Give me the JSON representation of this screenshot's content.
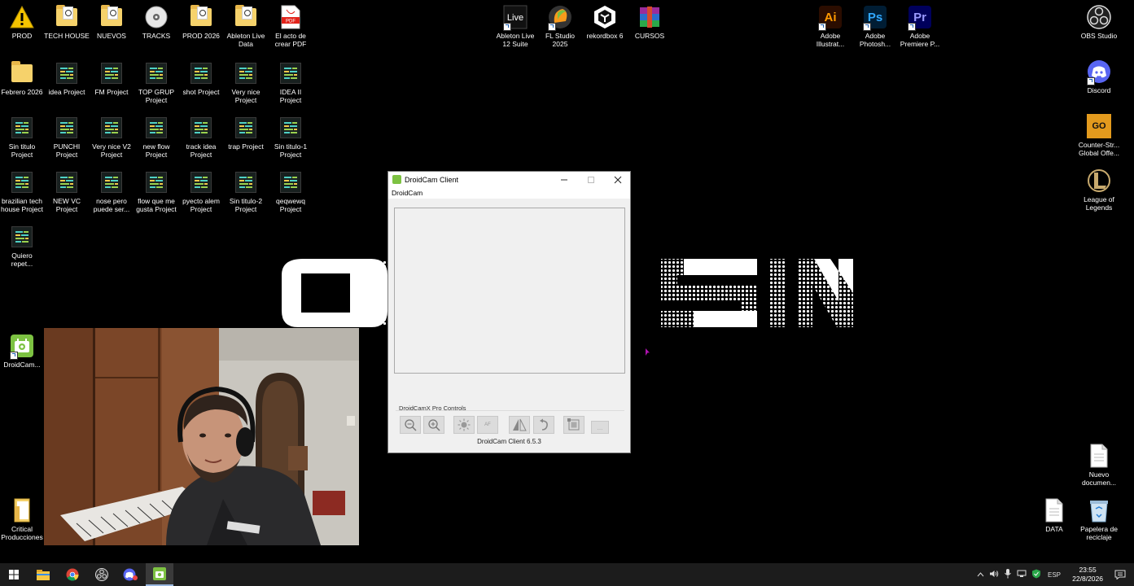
{
  "desktop": {
    "icons_left": [
      {
        "label": "PROD",
        "type": "warning"
      },
      {
        "label": "TECH HOUSE",
        "type": "folder"
      },
      {
        "label": "NUEVOS",
        "type": "folder"
      },
      {
        "label": "TRACKS",
        "type": "disc"
      },
      {
        "label": "PROD 2026",
        "type": "folder"
      },
      {
        "label": "Ableton Live\nData",
        "type": "folder"
      },
      {
        "label": "El acto de\ncrear PDF",
        "type": "pdf"
      },
      {
        "label": "Febrero 2026",
        "type": "folder-plain"
      },
      {
        "label": "idea Project",
        "type": "project"
      },
      {
        "label": "FM Project",
        "type": "project"
      },
      {
        "label": "TOP GRUP\nProject",
        "type": "project"
      },
      {
        "label": "shot Project",
        "type": "project"
      },
      {
        "label": "Very nice\nProject",
        "type": "project"
      },
      {
        "label": "IDEA II\nProject",
        "type": "project"
      },
      {
        "label": "Sin titulo\nProject",
        "type": "project"
      },
      {
        "label": "PUNCHI\nProject",
        "type": "project"
      },
      {
        "label": "Very nice V2\nProject",
        "type": "project"
      },
      {
        "label": "new flow\nProject",
        "type": "project"
      },
      {
        "label": "track idea\nProject",
        "type": "project"
      },
      {
        "label": "trap Project",
        "type": "project"
      },
      {
        "label": "Sin titulo-1\nProject",
        "type": "project"
      },
      {
        "label": "brazilian tech\nhouse Project",
        "type": "project"
      },
      {
        "label": "NEW VC\nProject",
        "type": "project"
      },
      {
        "label": "nose pero\npuede ser...",
        "type": "project"
      },
      {
        "label": "flow que me\ngusta Project",
        "type": "project"
      },
      {
        "label": "pyecto alem\nProject",
        "type": "project"
      },
      {
        "label": "Sin titulo-2\nProject",
        "type": "project"
      },
      {
        "label": "qeqwewq\nProject",
        "type": "project"
      },
      {
        "label": "Quiero\nrepet...",
        "type": "project"
      },
      {
        "label": "DroidCam...",
        "type": "droidcam"
      },
      {
        "label": "Critical\nProducciones",
        "type": "folder-doc"
      }
    ],
    "icons_top_center": [
      {
        "label": "Ableton Live\n12 Suite",
        "type": "live"
      },
      {
        "label": "FL Studio\n2025",
        "type": "fl"
      },
      {
        "label": "rekordbox 6",
        "type": "rekordbox"
      },
      {
        "label": "CURSOS",
        "type": "winrar"
      }
    ],
    "icons_top_right": [
      {
        "label": "Adobe\nIllustrat...",
        "type": "ai",
        "badge": "Ai"
      },
      {
        "label": "Adobe\nPhotosh...",
        "type": "ps",
        "badge": "Ps"
      },
      {
        "label": "Adobe\nPremiere P...",
        "type": "pr",
        "badge": "Pr"
      }
    ],
    "icons_right": [
      {
        "label": "OBS Studio",
        "type": "obs"
      },
      {
        "label": "Discord",
        "type": "discord"
      },
      {
        "label": "Counter-Str...\nGlobal Offe...",
        "type": "csgo",
        "badge": "GO"
      },
      {
        "label": "League of\nLegends",
        "type": "lol"
      },
      {
        "label": "Nuevo\ndocumen...",
        "type": "doc"
      },
      {
        "label": "DATA",
        "type": "doc"
      },
      {
        "label": "Papelera de\nreciclaje",
        "type": "bin"
      }
    ]
  },
  "window": {
    "title": "DroidCam Client",
    "menu": "DroidCam",
    "pro_controls_label": "DroidCamX Pro Controls",
    "status": "DroidCam Client 6.5.3",
    "tool_buttons": [
      "zoom-out",
      "zoom-in",
      "brightness",
      "autofocus",
      "mirror",
      "rotate",
      "video-settings",
      "more"
    ],
    "autofocus_label": "AF",
    "more_label": "..."
  },
  "taskbar": {
    "language": "ESP",
    "time": "23:55",
    "date": "22/8/2026"
  },
  "colors": {
    "desktop_bg": "#000000",
    "taskbar_bg": "#1c1c1c",
    "window_bg": "#f0f0f0",
    "droidcam_green": "#7dc242"
  }
}
